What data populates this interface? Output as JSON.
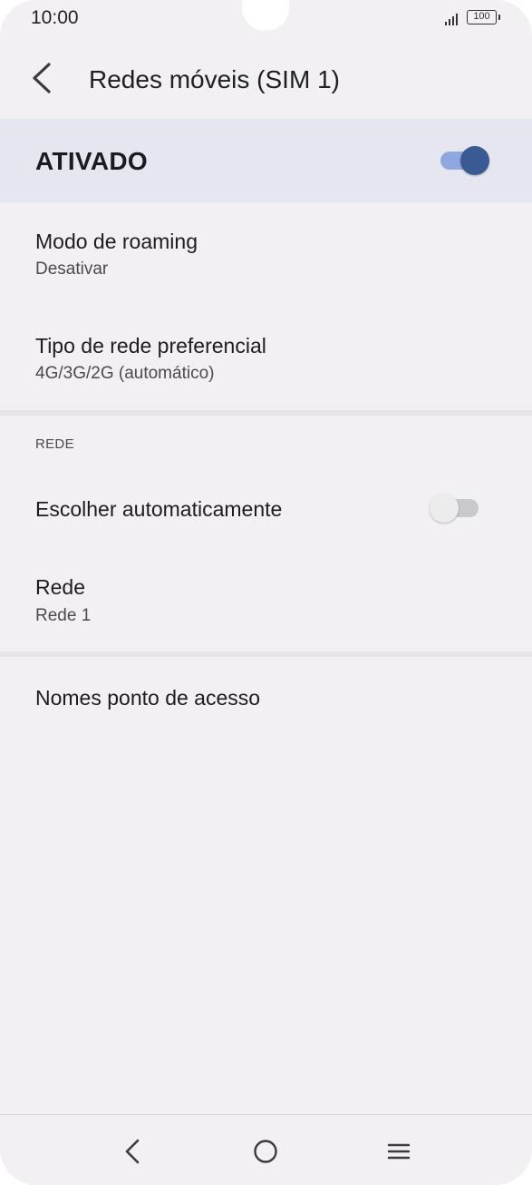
{
  "status_bar": {
    "time": "10:00",
    "battery_level": "100"
  },
  "app_bar": {
    "title": "Redes móveis (SIM 1)"
  },
  "master_switch": {
    "label": "ATIVADO",
    "checked": true
  },
  "preferences": {
    "roaming": {
      "title": "Modo de roaming",
      "summary": "Desativar"
    },
    "network_type": {
      "title": "Tipo de rede preferencial",
      "summary": "4G/3G/2G (automático)"
    }
  },
  "network_section": {
    "header": "REDE",
    "auto_select": {
      "title": "Escolher automaticamente",
      "checked": false
    },
    "network": {
      "title": "Rede",
      "summary": "Rede 1"
    }
  },
  "apn": {
    "title": "Nomes ponto de acesso"
  },
  "colors": {
    "accent": "#3a5a94",
    "accent_track": "#8fa8df",
    "background": "#f2f0f3",
    "highlight_row": "#e6e6f1"
  },
  "icons": {
    "back": "chevron-left-icon",
    "signal": "signal-icon",
    "battery": "battery-icon",
    "nav_back": "nav-back-icon",
    "nav_home": "home-circle-icon",
    "nav_menu": "menu-icon"
  }
}
